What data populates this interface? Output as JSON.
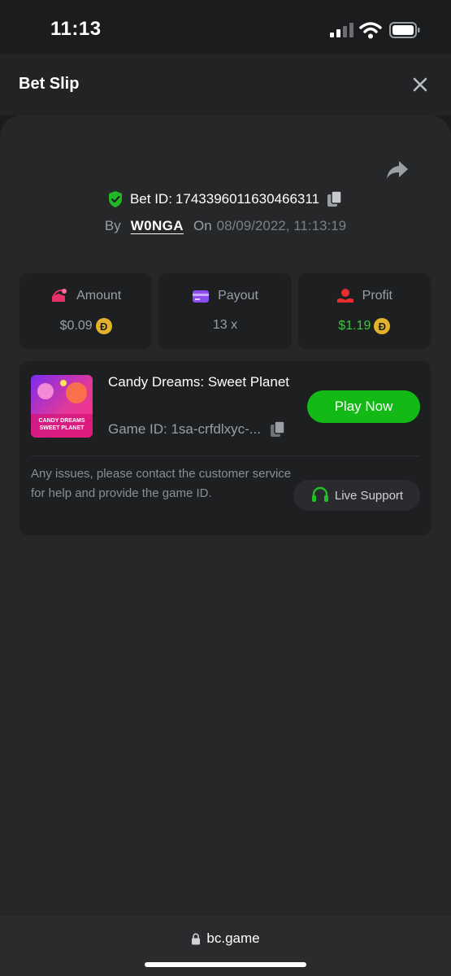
{
  "status_bar": {
    "time": "11:13"
  },
  "header": {
    "title": "Bet Slip"
  },
  "bet": {
    "id_label": "Bet ID:",
    "id_value": "1743396011630466311",
    "by_label": "By",
    "username": "W0NGA",
    "on_label": "On",
    "date": "08/09/2022, 11:13:19"
  },
  "stats": {
    "amount": {
      "label": "Amount",
      "value": "$0.09",
      "coin": "Đ"
    },
    "payout": {
      "label": "Payout",
      "value": "13 x"
    },
    "profit": {
      "label": "Profit",
      "value": "$1.19",
      "coin": "Đ"
    }
  },
  "game": {
    "name": "Candy Dreams: Sweet Planet",
    "id_text": "Game ID: 1sa-crfdlxyc-...",
    "thumb_line1": "CANDY DREAMS",
    "thumb_line2": "SWEET PLANET",
    "play_label": "Play Now",
    "issues_text": "Any issues, please contact the customer service for help and provide the game ID.",
    "support_label": "Live Support"
  },
  "browser": {
    "url": "bc.game"
  },
  "colors": {
    "accent_green": "#13b915",
    "profit_green": "#3cc63c",
    "coin_gold": "#e3b12a"
  },
  "icons": [
    "signal-icon",
    "wifi-icon",
    "battery-icon",
    "close-icon",
    "share-icon",
    "shield-check-icon",
    "copy-icon",
    "amount-icon",
    "payout-card-icon",
    "profit-icon",
    "headset-icon",
    "lock-icon"
  ]
}
